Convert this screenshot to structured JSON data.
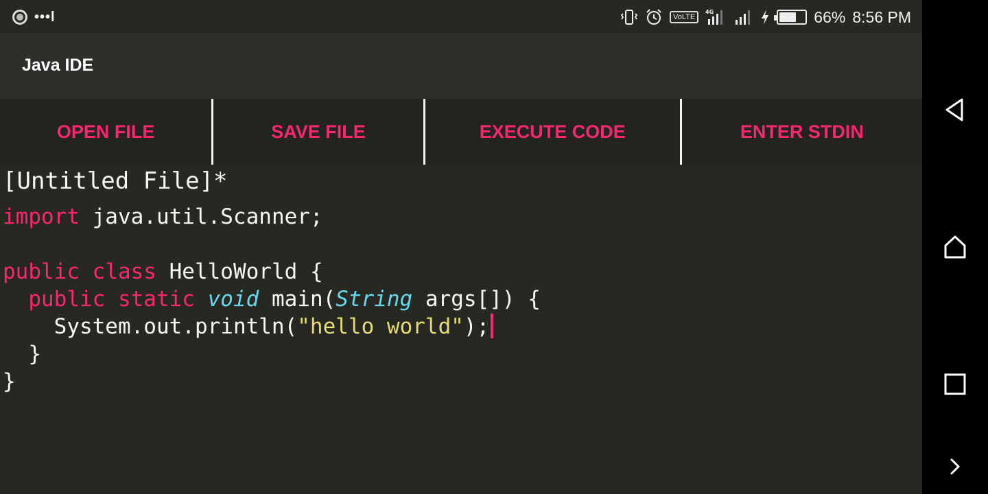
{
  "status_bar": {
    "notification_dots": "•••l",
    "volte_label": "VoLTE",
    "network_label": "4G",
    "battery_text": "66%",
    "battery_level": 0.66,
    "time": "8:56 PM"
  },
  "app_bar": {
    "title": "Java IDE"
  },
  "toolbar": {
    "open_label": "OPEN FILE",
    "save_label": "SAVE FILE",
    "execute_label": "EXECUTE CODE",
    "stdin_label": "ENTER STDIN"
  },
  "editor": {
    "file_name": "[Untitled File]*",
    "lines": [
      [
        {
          "text": "import",
          "type": "kw"
        },
        {
          "text": " java.util.Scanner;",
          "type": "plain"
        }
      ],
      [],
      [
        {
          "text": "public",
          "type": "kw"
        },
        {
          "text": " ",
          "type": "plain"
        },
        {
          "text": "class",
          "type": "kw"
        },
        {
          "text": " HelloWorld {",
          "type": "plain"
        }
      ],
      [
        {
          "text": "  ",
          "type": "plain"
        },
        {
          "text": "public",
          "type": "kw"
        },
        {
          "text": " ",
          "type": "plain"
        },
        {
          "text": "static",
          "type": "kw"
        },
        {
          "text": " ",
          "type": "plain"
        },
        {
          "text": "void",
          "type": "ty"
        },
        {
          "text": " main(",
          "type": "plain"
        },
        {
          "text": "String",
          "type": "ty"
        },
        {
          "text": " args[]) {",
          "type": "plain"
        }
      ],
      [
        {
          "text": "    System.out.println(",
          "type": "plain"
        },
        {
          "text": "\"hello world\"",
          "type": "str"
        },
        {
          "text": ");",
          "type": "plain"
        },
        {
          "text": "",
          "type": "caret"
        }
      ],
      [
        {
          "text": "  }",
          "type": "plain"
        }
      ],
      [
        {
          "text": "}",
          "type": "plain"
        }
      ]
    ]
  },
  "colors": {
    "accent": "#f92672",
    "keyword": "#f92672",
    "type": "#66d9ef",
    "string": "#e6db74",
    "background": "#272822"
  },
  "nav_bar": {
    "icons": [
      "back-icon",
      "home-icon",
      "recents-icon",
      "expand-icon"
    ]
  }
}
